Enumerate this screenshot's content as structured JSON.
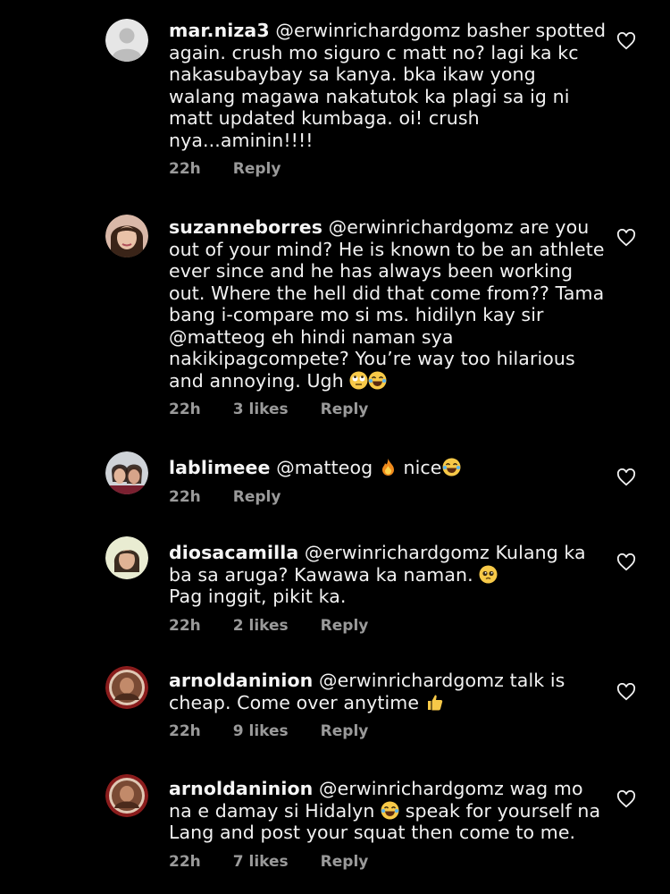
{
  "comments": [
    {
      "username": "mar.niza3",
      "text": "@erwinrichardgomz basher spotted again. crush mo siguro c matt no? lagi ka kc nakasubaybay sa kanya. bka ikaw yong walang magawa nakatutok ka plagi sa ig ni matt updated kumbaga. oi! crush nya...aminin!!!!",
      "time": "22h",
      "likes": "",
      "reply": "Reply",
      "avatar": "default-avatar-icon"
    },
    {
      "username": "suzanneborres",
      "text": "@erwinrichardgomz are you out of your mind? He is known to be an athlete ever since and he has always been working out. Where the hell did that come from?? Tama bang i-compare mo si ms. hidilyn kay sir @matteog eh hindi naman sya nakikipagcompete? You’re way too hilarious and annoying. Ugh",
      "emojis": [
        "eye-roll-emoji",
        "laughing-emoji"
      ],
      "time": "22h",
      "likes": "3 likes",
      "reply": "Reply",
      "avatar": "profile-photo"
    },
    {
      "username": "lablimeee",
      "text": "@matteog",
      "emoji_mid": "fire-emoji",
      "text_after": "nice",
      "emojis": [
        "laughing-emoji"
      ],
      "time": "22h",
      "likes": "",
      "reply": "Reply",
      "avatar": "profile-photo"
    },
    {
      "username": "diosacamilla",
      "text": "@erwinrichardgomz Kulang ka ba sa aruga? Kawawa ka naman.",
      "emojis": [
        "pleading-emoji"
      ],
      "text_line2": "Pag inggit, pikit ka.",
      "time": "22h",
      "likes": "2 likes",
      "reply": "Reply",
      "avatar": "profile-photo"
    },
    {
      "username": "arnoldaninion",
      "text": "@erwinrichardgomz  talk is cheap. Come over anytime",
      "emojis": [
        "thumbs-up-emoji"
      ],
      "time": "22h",
      "likes": "9 likes",
      "reply": "Reply",
      "avatar": "profile-photo"
    },
    {
      "username": "arnoldaninion",
      "text": "@erwinrichardgomz  wag mo na e damay si Hidalyn",
      "emoji_mid": "laughing-emoji",
      "text_after": "speak for yourself na Lang and post your squat then come to me.",
      "time": "22h",
      "likes": "7 likes",
      "reply": "Reply",
      "avatar": "profile-photo"
    }
  ],
  "colors": {
    "background": "#000000",
    "text": "#f2f2f2",
    "meta": "#9a9a9a"
  }
}
